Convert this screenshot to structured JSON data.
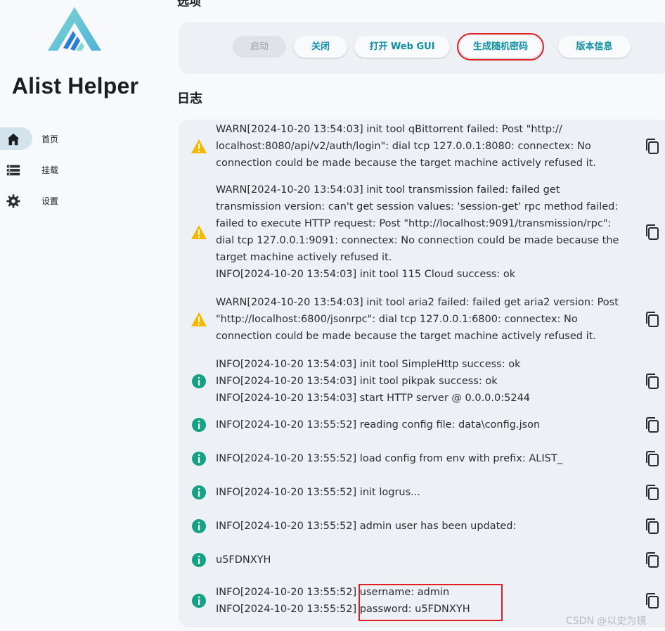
{
  "app": {
    "title": "Alist Helper",
    "logo_icon": "alist-logo-icon",
    "accent_color": "#0f8fa6"
  },
  "sidebar": {
    "items": [
      {
        "label": "首页",
        "icon": "home-icon",
        "active": true
      },
      {
        "label": "挂载",
        "icon": "list-icon",
        "active": false
      },
      {
        "label": "设置",
        "icon": "gear-icon",
        "active": false
      }
    ]
  },
  "options": {
    "section_title": "选项",
    "buttons": [
      {
        "label": "启动",
        "disabled": true
      },
      {
        "label": "关闭",
        "disabled": false
      },
      {
        "label": "打开 Web GUI",
        "disabled": false
      },
      {
        "label": "生成随机密码",
        "disabled": false,
        "highlighted": true
      },
      {
        "label": "版本信息",
        "disabled": false
      }
    ]
  },
  "logs": {
    "section_title": "日志",
    "copy_icon": "copy-icon",
    "entries": [
      {
        "level": "warn",
        "lines": [
          "WARN[2024-10-20 13:54:03] init tool qBittorrent failed: Post \"http://",
          "localhost:8080/api/v2/auth/login\": dial tcp 127.0.0.1:8080: connectex: No",
          "connection could be made because the target machine actively refused it."
        ]
      },
      {
        "level": "warn",
        "lines": [
          "WARN[2024-10-20 13:54:03] init tool transmission failed: failed get",
          "transmission version: can't get session values: 'session-get' rpc method failed:",
          "failed to execute HTTP request: Post \"http://localhost:9091/transmission/rpc\":",
          "dial tcp 127.0.0.1:9091: connectex: No connection could be made because the",
          "target machine actively refused it.",
          "INFO[2024-10-20 13:54:03] init tool 115 Cloud success: ok"
        ]
      },
      {
        "level": "warn",
        "lines": [
          "WARN[2024-10-20 13:54:03] init tool aria2 failed: failed get aria2 version: Post",
          "\"http://localhost:6800/jsonrpc\": dial tcp 127.0.0.1:6800: connectex: No",
          "connection could be made because the target machine actively refused it."
        ]
      },
      {
        "level": "info",
        "lines": [
          "INFO[2024-10-20 13:54:03] init tool SimpleHttp success: ok",
          "INFO[2024-10-20 13:54:03] init tool pikpak success: ok",
          "INFO[2024-10-20 13:54:03] start HTTP server @ 0.0.0.0:5244"
        ]
      },
      {
        "level": "info",
        "lines": [
          "INFO[2024-10-20 13:55:52] reading config file: data\\config.json"
        ]
      },
      {
        "level": "info",
        "lines": [
          "INFO[2024-10-20 13:55:52] load config from env with prefix: ALIST_"
        ]
      },
      {
        "level": "info",
        "lines": [
          "INFO[2024-10-20 13:55:52] init logrus..."
        ]
      },
      {
        "level": "info",
        "lines": [
          "INFO[2024-10-20 13:55:52] admin user has been updated:"
        ]
      },
      {
        "level": "info",
        "lines": [
          "u5FDNXYH"
        ]
      },
      {
        "level": "info",
        "lines": [
          "INFO[2024-10-20 13:55:52] username: admin",
          "INFO[2024-10-20 13:55:52] password: u5FDNXYH"
        ]
      }
    ]
  },
  "colors": {
    "warn": "#f5b800",
    "info": "#16a085",
    "highlight_box": "#e02020"
  },
  "watermark": "CSDN @以史为镜"
}
